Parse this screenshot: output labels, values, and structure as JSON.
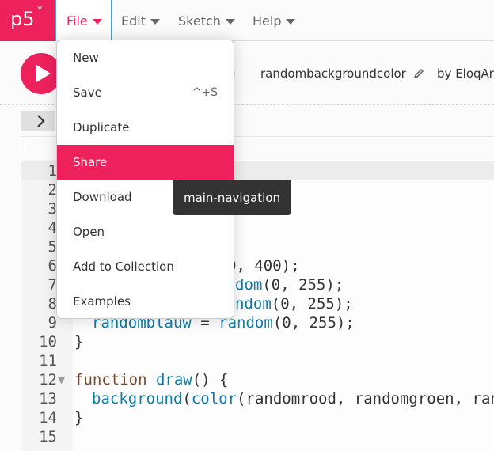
{
  "brand": {
    "logo_text": "p5",
    "logo_star": "*",
    "color": "#ed225d"
  },
  "nav": {
    "file": "File",
    "edit": "Edit",
    "sketch": "Sketch",
    "help": "Help"
  },
  "toolbar": {
    "partial_label": "n",
    "sketch_name": "randombackgroundcolor",
    "by_label": "by",
    "author": "EloqAr"
  },
  "file_menu": {
    "items": [
      {
        "label": "New",
        "shortcut": ""
      },
      {
        "label": "Save",
        "shortcut": "^+S"
      },
      {
        "label": "Duplicate",
        "shortcut": ""
      },
      {
        "label": "Share",
        "shortcut": ""
      },
      {
        "label": "Download",
        "shortcut": ""
      },
      {
        "label": "Open",
        "shortcut": ""
      },
      {
        "label": "Add to Collection",
        "shortcut": ""
      },
      {
        "label": "Examples",
        "shortcut": ""
      }
    ],
    "highlighted": "Share"
  },
  "tooltip": "main-navigation",
  "editor": {
    "line_numbers": [
      "1",
      "2",
      "3",
      "4",
      "5",
      "6",
      "7",
      "8",
      "9",
      "10",
      "11",
      "12",
      "13",
      "14",
      "15"
    ],
    "lines": {
      "l6": "0, 400);",
      "l7_fn": "dom",
      "l7_rest": "(0, 255);",
      "l8_fn": "ndom",
      "l8_rest": "(0, 255);",
      "l9_var": "randomblauw",
      "l9_eq": " = ",
      "l9_fn": "random",
      "l9_rest": "(0, 255);",
      "l10": "}",
      "l12_kw": "function",
      "l12_fn": "draw",
      "l12_rest": "() {",
      "l13_fn1": "background",
      "l13_p1": "(",
      "l13_fn2": "color",
      "l13_p2": "(",
      "l13_a1": "randomrood",
      "l13_c1": ", ",
      "l13_a2": "randomgroen",
      "l13_c2": ", ",
      "l13_a3": "ran",
      "l14": "}"
    }
  }
}
